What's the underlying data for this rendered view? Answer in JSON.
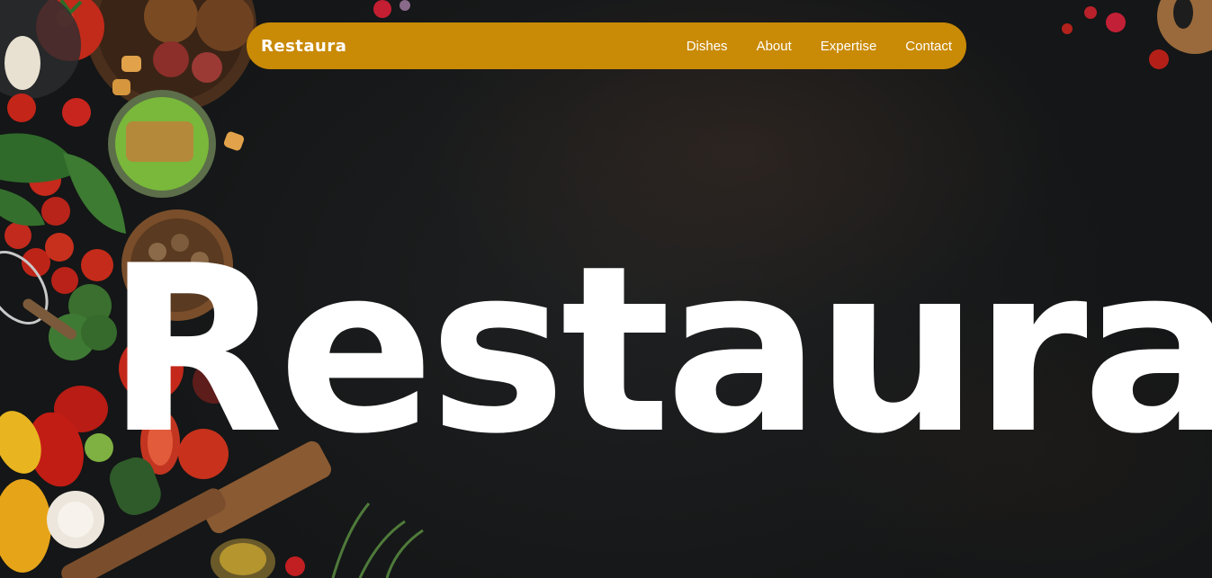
{
  "nav": {
    "logo": "Restaura",
    "links": [
      "Dishes",
      "About",
      "Expertise",
      "Contact"
    ]
  },
  "hero": {
    "title": "Restaura"
  },
  "colors": {
    "accent": "#c98a06",
    "background": "#161819",
    "text": "#ffffff"
  },
  "background_image": "dark slate table with fresh vegetables, bowls and wooden utensils along the left edge"
}
